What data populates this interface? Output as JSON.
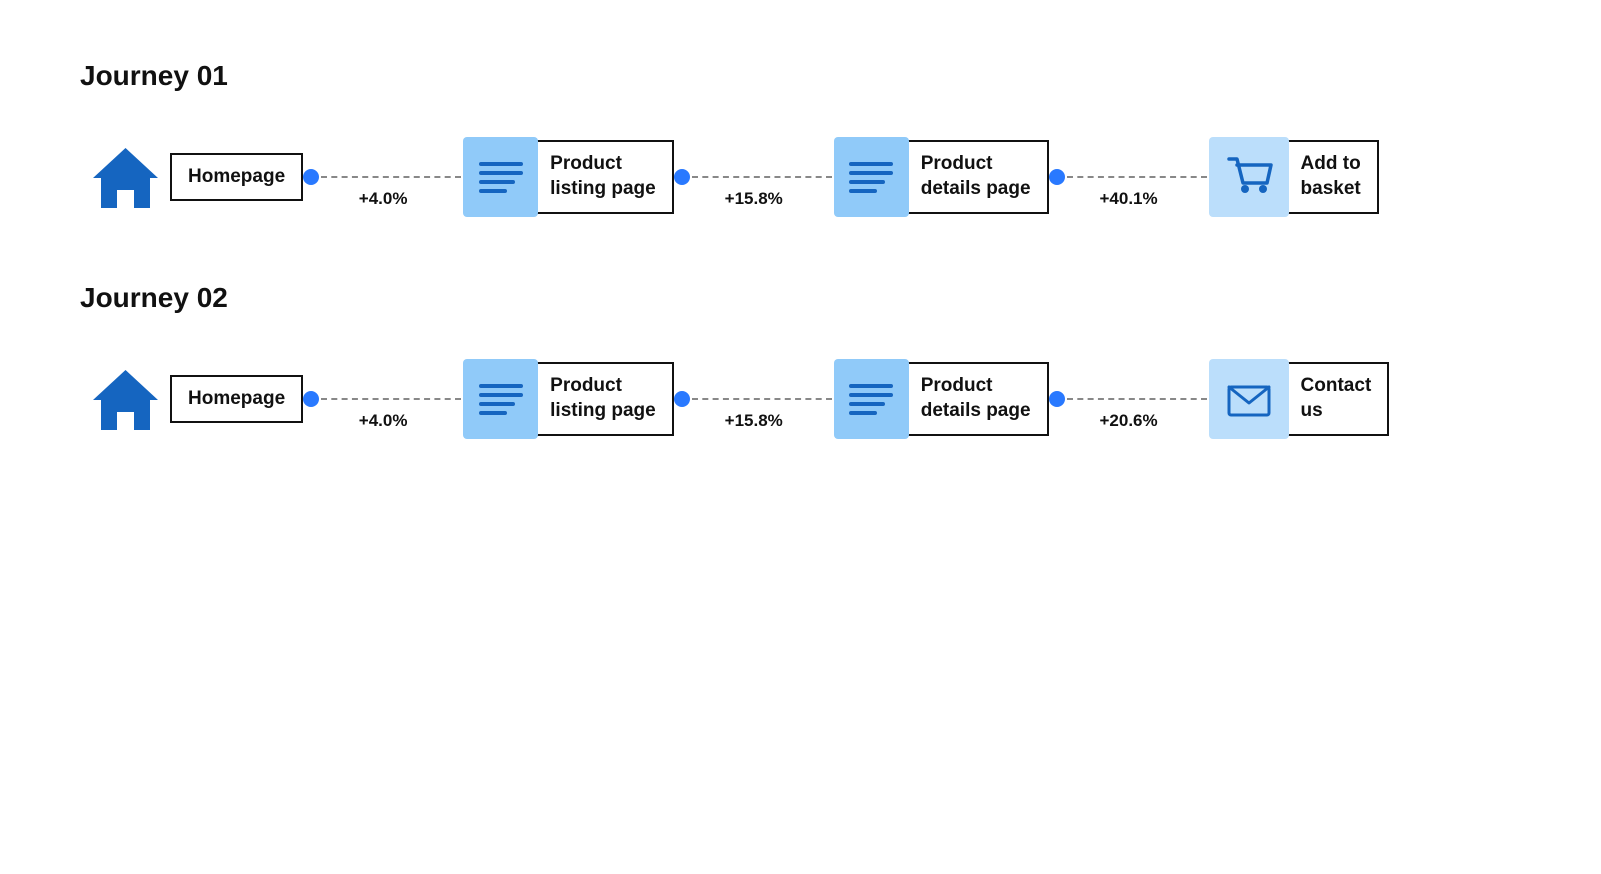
{
  "journey1": {
    "title": "Journey 01",
    "nodes": [
      {
        "type": "home",
        "label": "Homepage"
      },
      {
        "type": "page",
        "label": "Product\nlisting page",
        "percent": "+4.0%"
      },
      {
        "type": "page",
        "label": "Product\ndetails page",
        "percent": "+15.8%"
      },
      {
        "type": "cart",
        "label": "Add to\nbasket",
        "percent": "+40.1%"
      }
    ]
  },
  "journey2": {
    "title": "Journey 02",
    "nodes": [
      {
        "type": "home",
        "label": "Homepage"
      },
      {
        "type": "page",
        "label": "Product\nlisting page",
        "percent": "+4.0%"
      },
      {
        "type": "page",
        "label": "Product\ndetails page",
        "percent": "+15.8%"
      },
      {
        "type": "email",
        "label": "Contact\nus",
        "percent": "+20.6%"
      }
    ]
  }
}
